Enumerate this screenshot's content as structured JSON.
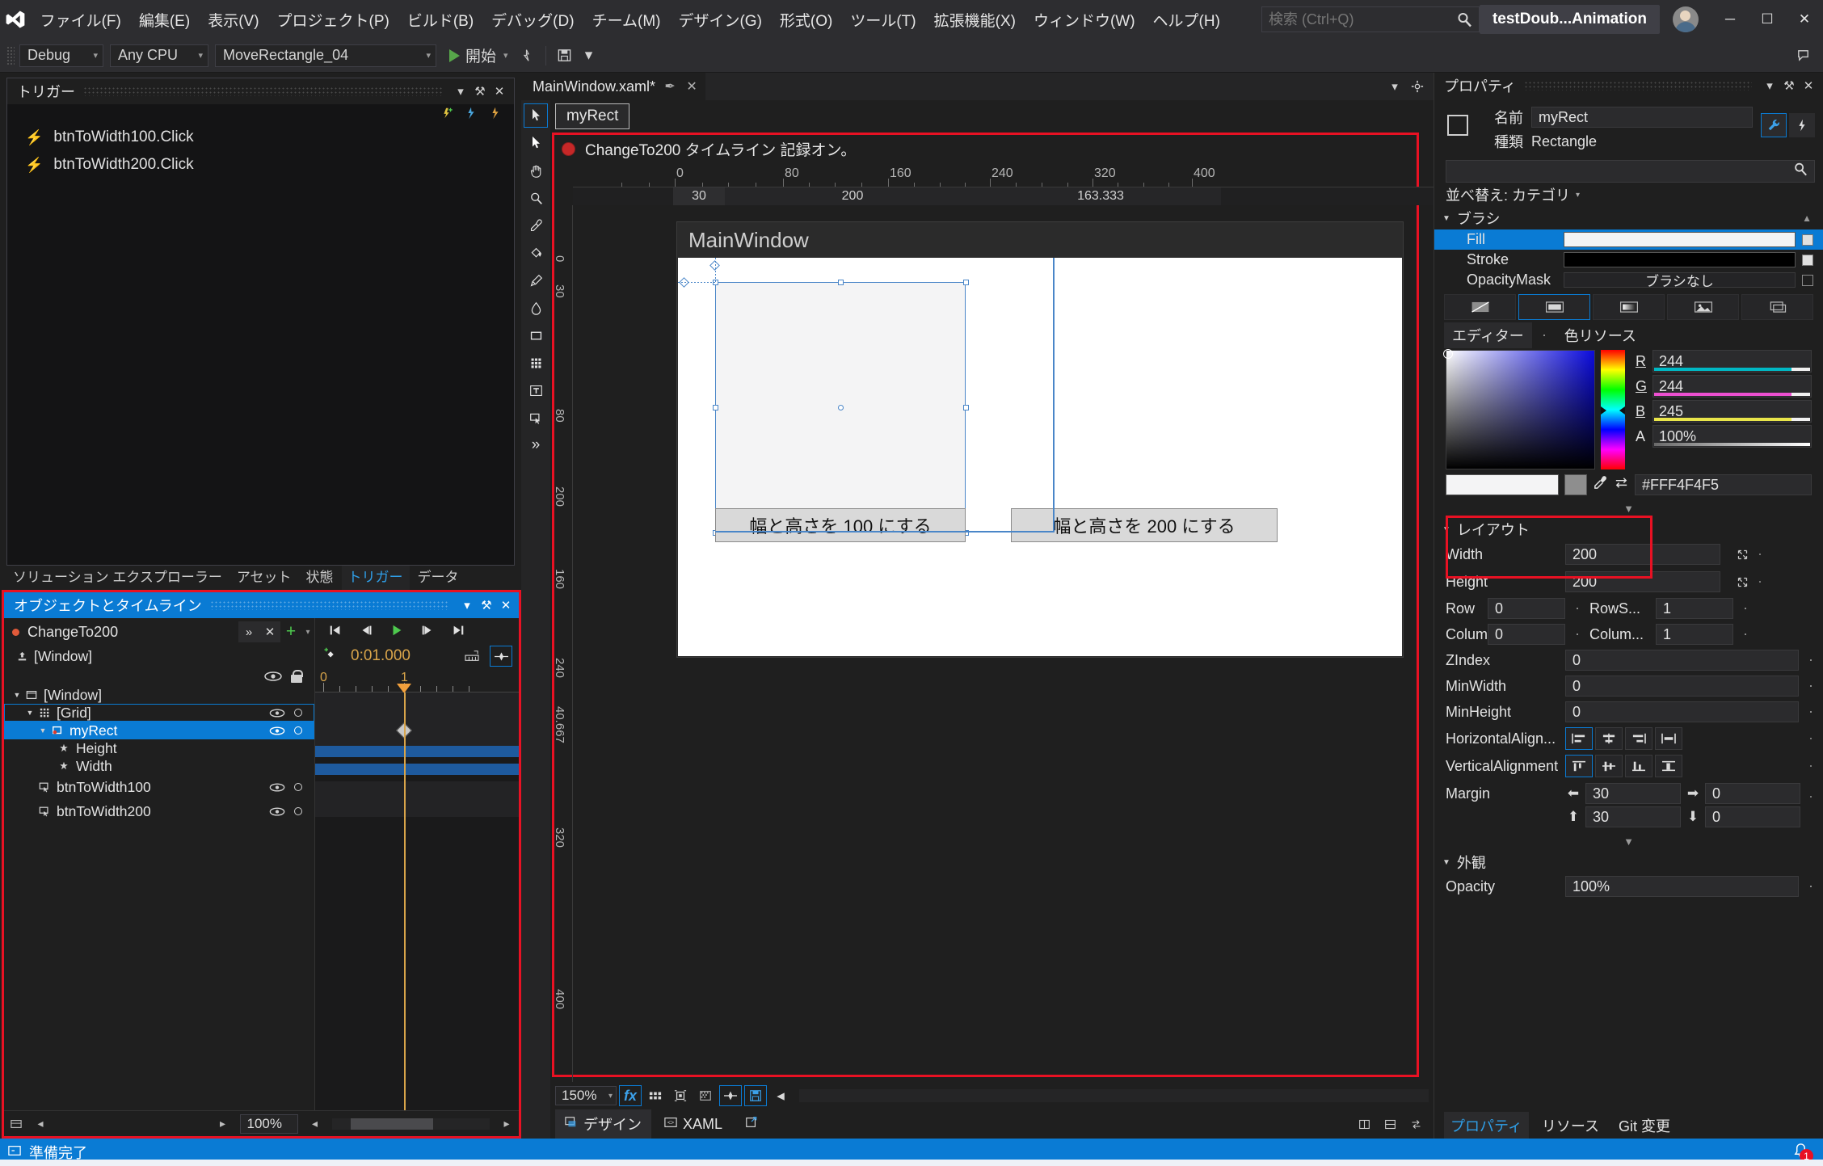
{
  "titlebar": {
    "logo_icon": "visual-studio-logo",
    "menus": [
      {
        "label": "ファイル(F)",
        "key": "F"
      },
      {
        "label": "編集(E)",
        "key": "E"
      },
      {
        "label": "表示(V)",
        "key": "V"
      },
      {
        "label": "プロジェクト(P)",
        "key": "P"
      },
      {
        "label": "ビルド(B)",
        "key": "B"
      },
      {
        "label": "デバッグ(D)",
        "key": "D"
      },
      {
        "label": "チーム(M)",
        "key": "M"
      },
      {
        "label": "デザイン(G)",
        "key": "G"
      },
      {
        "label": "形式(O)",
        "key": "O"
      },
      {
        "label": "ツール(T)",
        "key": "T"
      },
      {
        "label": "拡張機能(X)",
        "key": "X"
      },
      {
        "label": "ウィンドウ(W)",
        "key": "W"
      },
      {
        "label": "ヘルプ(H)",
        "key": "H"
      }
    ],
    "search_placeholder": "検索 (Ctrl+Q)",
    "search_value": "",
    "project_chip": "testDoub...Animation",
    "minimize": "─",
    "maximize": "☐",
    "close": "✕"
  },
  "toolbar": {
    "configuration": "Debug",
    "platform": "Any CPU",
    "startup_project": "MoveRectangle_04",
    "run_label": "開始",
    "dropdown_arrow": "▾"
  },
  "trigger_panel": {
    "title": "トリガー",
    "items": [
      {
        "label": "btnToWidth100.Click",
        "icon": "lightning-icon"
      },
      {
        "label": "btnToWidth200.Click",
        "icon": "lightning-icon"
      }
    ],
    "collapse": "▾",
    "pin": "⚒",
    "close": "✕"
  },
  "left_tabs": [
    {
      "label": "ソリューション エクスプローラー",
      "active": false
    },
    {
      "label": "アセット",
      "active": false
    },
    {
      "label": "状態",
      "active": false
    },
    {
      "label": "トリガー",
      "active": true
    },
    {
      "label": "データ",
      "active": false
    }
  ],
  "timeline_panel": {
    "title": "オブジェクトとタイムライン",
    "collapse": "▾",
    "pin": "⚒",
    "close": "✕",
    "storyboard_name": "ChangeTo200",
    "storyboard_buttons": [
      "»",
      "✕",
      "+",
      "▾"
    ],
    "playback": [
      "skip-to-start",
      "step-back",
      "play",
      "step-forward",
      "skip-to-end"
    ],
    "time_value": "0:01.000",
    "snap_icon": "snap-to-grid-icon",
    "keyframe_icon": "keyframe-resolution-icon",
    "ruler_labels": [
      "0",
      "1"
    ],
    "tree": [
      {
        "label": "[Window]",
        "depth": 0,
        "icon": "artboard-icon",
        "eye": false,
        "lock": true,
        "selected": false,
        "outline": false
      },
      {
        "label": "[Window]",
        "depth": 0,
        "icon": "window-icon",
        "eye": false,
        "lock": false,
        "selected": false,
        "outline": false,
        "expander": true
      },
      {
        "label": "[Grid]",
        "depth": 1,
        "icon": "grid-icon",
        "eye": true,
        "circle": true,
        "selected": false,
        "outline": true,
        "expander": true
      },
      {
        "label": "myRect",
        "depth": 2,
        "icon": "rectangle-icon",
        "eye": true,
        "circle": true,
        "selected": true,
        "outline": false,
        "expander": true
      },
      {
        "label": "Height",
        "depth": 3,
        "icon": "property-icon",
        "eye": false,
        "circle": false,
        "selected": false,
        "outline": false
      },
      {
        "label": "Width",
        "depth": 3,
        "icon": "property-icon",
        "eye": false,
        "circle": false,
        "selected": false,
        "outline": false
      },
      {
        "label": "btnToWidth100",
        "depth": 2,
        "icon": "button-icon",
        "eye": true,
        "circle": true,
        "selected": false,
        "outline": false
      },
      {
        "label": "btnToWidth200",
        "depth": 2,
        "icon": "button-icon",
        "eye": true,
        "circle": true,
        "selected": false,
        "outline": false
      }
    ],
    "zoom": "100%"
  },
  "document": {
    "tab_label": "MainWindow.xaml*",
    "tab_pin": "✒",
    "tab_close": "✕",
    "panel_collapse": "▾",
    "panel_settings": "gear-icon"
  },
  "designer": {
    "object_chip": "myRect",
    "recording_message": "ChangeTo200 タイムライン 記録オン。",
    "ruler_h_labels": [
      "0",
      "80",
      "160",
      "240",
      "320",
      "400"
    ],
    "ruler_sub_labels": [
      "30",
      "200",
      "163.333"
    ],
    "ruler_v_labels": [
      "0",
      "30",
      "80",
      "200",
      "160",
      "240",
      "40.667",
      "320",
      "400"
    ],
    "window_title": "MainWindow",
    "button_100": "幅と高さを 100 にする",
    "button_200": "幅と高さを 200 にする",
    "zoom": "150%",
    "bottom_icons": [
      "fx",
      "grid-icon",
      "artboard-snap-icon",
      "effects-icon",
      "snap-icon",
      "save-state-icon"
    ],
    "view_tabs": [
      {
        "label": "デザイン",
        "icon": "design-icon",
        "active": true
      },
      {
        "label": "XAML",
        "icon": "xaml-icon",
        "active": false
      }
    ],
    "popout_icon": "pop-out-icon"
  },
  "properties": {
    "title": "プロパティ",
    "collapse": "▾",
    "pin": "⚒",
    "close": "✕",
    "name_label": "名前",
    "name_value": "myRect",
    "type_label": "種類",
    "type_value": "Rectangle",
    "wrench_icon": "wrench-icon",
    "events_icon": "lightning-icon",
    "search_placeholder": "",
    "sort_label": "並べ替え: カテゴリ",
    "brush_section": "ブラシ",
    "brush_rows": [
      {
        "label": "Fill",
        "value": "#FFF4F4F5",
        "selected": true,
        "swatch": "#f4f4f5",
        "checked": true
      },
      {
        "label": "Stroke",
        "value": "",
        "selected": false,
        "swatch": "#000000",
        "checked": true
      },
      {
        "label": "OpacityMask",
        "value": "ブラシなし",
        "selected": false,
        "swatch": "",
        "checked": false
      }
    ],
    "brush_tab_icons": [
      "no-brush-icon",
      "solid-color-brush-icon",
      "gradient-brush-icon",
      "image-brush-icon",
      "resource-brush-icon"
    ],
    "brush_tab_active": 1,
    "editor_tab": "エディター",
    "color_resource_tab": "色リソース",
    "channels": [
      {
        "label": "R",
        "value": "244"
      },
      {
        "label": "G",
        "value": "244"
      },
      {
        "label": "B",
        "value": "245"
      },
      {
        "label": "A",
        "value": "100%"
      }
    ],
    "hex_value": "#FFF4F4F5",
    "eyedropper_icon": "eyedropper-icon",
    "swap_icon": "swap-icon",
    "layout_section": "レイアウト",
    "layout_rows": [
      {
        "label": "Width",
        "value": "200"
      },
      {
        "label": "Height",
        "value": "200"
      }
    ],
    "grid_rows": [
      {
        "label": "Row",
        "value": "0",
        "label2": "RowS...",
        "value2": "1"
      },
      {
        "label": "Column",
        "value": "0",
        "label2": "Colum...",
        "value2": "1"
      }
    ],
    "simple_rows": [
      {
        "label": "ZIndex",
        "value": "0"
      },
      {
        "label": "MinWidth",
        "value": "0"
      },
      {
        "label": "MinHeight",
        "value": "0"
      }
    ],
    "halign_label": "HorizontalAlign...",
    "valign_label": "VerticalAlignment",
    "halign_active": 0,
    "valign_active": 0,
    "margin_label": "Margin",
    "margin_left": "30",
    "margin_right": "0",
    "margin_top": "30",
    "margin_bottom": "0",
    "appearance_section": "外観",
    "opacity_label": "Opacity",
    "opacity_value": "100%",
    "tabs": [
      {
        "label": "プロパティ",
        "active": true
      },
      {
        "label": "リソース",
        "active": false
      },
      {
        "label": "Git 変更",
        "active": false
      }
    ]
  },
  "statusbar": {
    "text": "準備完了",
    "bell_icon": "bell-icon",
    "bell_count": "1"
  }
}
